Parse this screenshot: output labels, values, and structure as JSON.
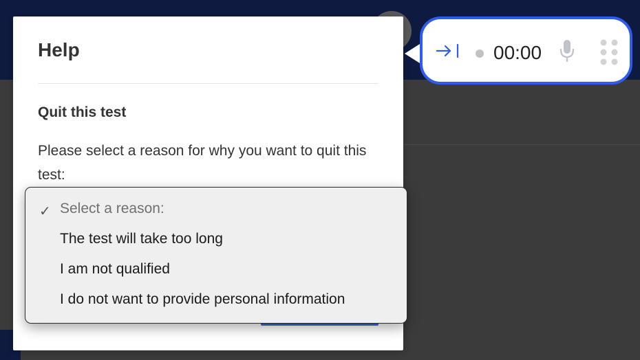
{
  "help": {
    "title": "Help",
    "subtitle": "Quit this test",
    "description": "Please select a reason for why you want to quit this test:"
  },
  "reason_dropdown": {
    "options": [
      "Select a reason:",
      "The test will take too long",
      "I am not qualified",
      "I do not want to provide personal information"
    ],
    "selected_index": 0
  },
  "recorder": {
    "time": "00:00",
    "icons": [
      "collapse-to-side-icon",
      "recording-indicator",
      "microphone-icon",
      "drag-handle-icon"
    ],
    "accent_color": "#2f5cf0"
  },
  "colors": {
    "accent": "#2f5cf0",
    "top_bar": "#0f1a40",
    "backdrop": "#3b3b3b"
  }
}
